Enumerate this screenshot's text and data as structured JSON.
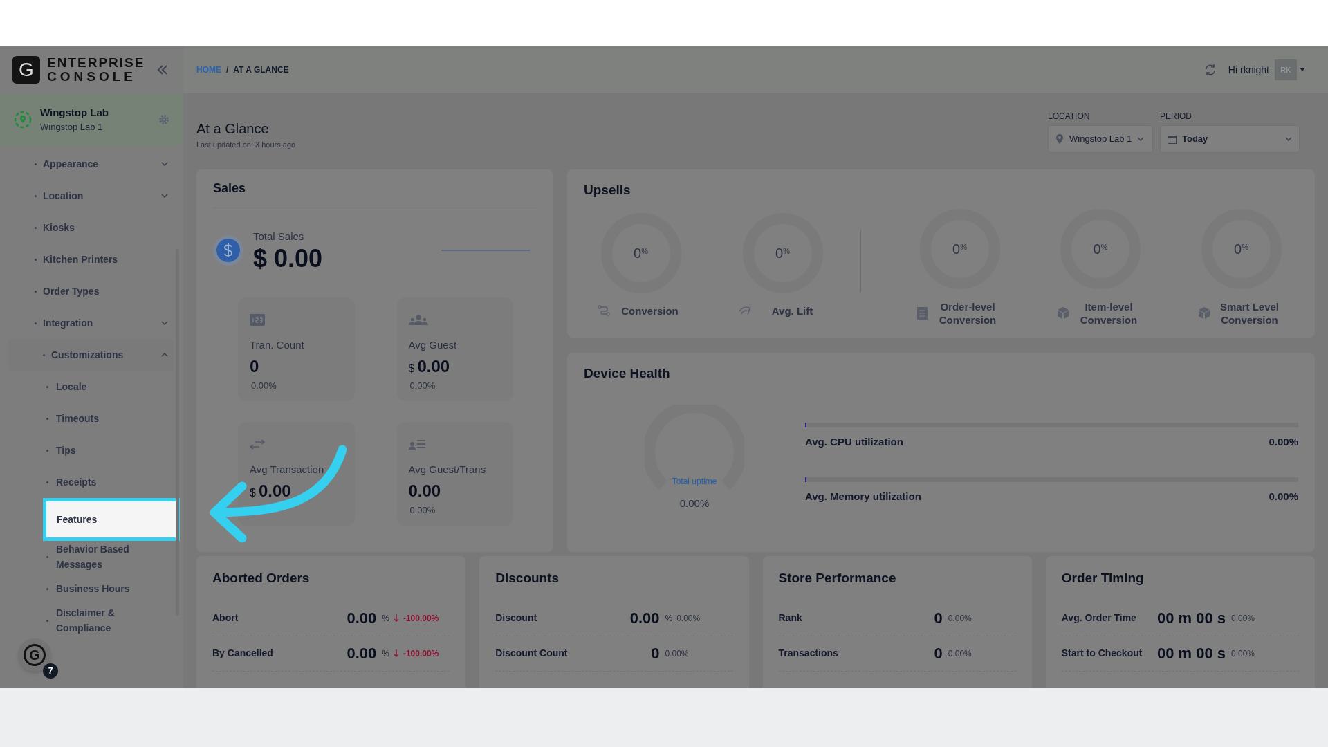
{
  "brand": {
    "logo_letter": "G",
    "line_1": "ENTERPRISE",
    "line_2": "CONSOLE"
  },
  "store": {
    "name": "Wingstop Lab",
    "subtitle": "Wingstop Lab 1"
  },
  "sidebar": {
    "items": [
      {
        "label": "Appearance",
        "expanded": false,
        "selected": false
      },
      {
        "label": "Location",
        "expanded": false,
        "selected": false
      },
      {
        "label": "Kiosks",
        "selected": false
      },
      {
        "label": "Kitchen Printers",
        "selected": false
      },
      {
        "label": "Order Types",
        "selected": false
      },
      {
        "label": "Integration",
        "expanded": false,
        "selected": false
      },
      {
        "label": "Customizations",
        "expanded": true,
        "selected": false,
        "children": [
          {
            "label": "Locale",
            "selected": false
          },
          {
            "label": "Timeouts",
            "selected": false
          },
          {
            "label": "Tips",
            "selected": false
          },
          {
            "label": "Receipts",
            "selected": false
          },
          {
            "label": "Features",
            "selected": true
          },
          {
            "label": "Behavior Based Messages",
            "selected": false
          },
          {
            "label": "Business Hours",
            "selected": false
          },
          {
            "label": "Disclaimer & Compliance",
            "selected": false
          }
        ]
      }
    ]
  },
  "breadcrumb": {
    "separator": "/",
    "items": [
      {
        "kind": "link",
        "label": "HOME"
      },
      {
        "kind": "current",
        "label": "AT A GLANCE"
      }
    ]
  },
  "user": {
    "greeting": "Hi rknight",
    "initials": "RK"
  },
  "page": {
    "title": "At a Glance",
    "subtitle": "Last updated on: 3 hours ago"
  },
  "filters": [
    {
      "kind": "location",
      "label": "LOCATION",
      "value": "Wingstop Lab 1"
    },
    {
      "kind": "period",
      "label": "PERIOD",
      "value": "Today"
    }
  ],
  "sales": {
    "title": "Sales",
    "total": {
      "label": "Total Sales",
      "currency": "$",
      "value": "0.00"
    },
    "metrics": [
      {
        "kind": "numbers",
        "label": "Tran. Count",
        "value": "0",
        "change": "0.00%"
      },
      {
        "kind": "group",
        "label": "Avg Guest",
        "currency": "$",
        "value": "0.00",
        "change": "0.00%"
      },
      {
        "kind": "swap",
        "label": "Avg Transaction",
        "currency": "$",
        "value": "0.00"
      },
      {
        "kind": "guest-list",
        "label": "Avg Guest/Trans",
        "value": "0.00",
        "change": "0.00%"
      }
    ]
  },
  "upsells": {
    "title": "Upsells",
    "groups": [
      [
        {
          "kind": "route",
          "label": "Conversion",
          "value": "0",
          "unit": "%"
        },
        {
          "kind": "signal",
          "label": "Avg. Lift",
          "value": "0",
          "unit": "%"
        }
      ],
      [
        {
          "kind": "list",
          "label": "Order-level Conversion",
          "value": "0",
          "unit": "%"
        },
        {
          "kind": "cube",
          "label": "Item-level Conversion",
          "value": "0",
          "unit": "%"
        },
        {
          "kind": "cube",
          "label": "Smart Level Conversion",
          "value": "0",
          "unit": "%"
        }
      ]
    ]
  },
  "device_health": {
    "title": "Device Health",
    "uptime": {
      "label": "Total uptime",
      "value": "0.00%"
    },
    "bars": [
      {
        "label": "Avg. CPU utilization",
        "value": "0.00%",
        "level": 0
      },
      {
        "label": "Avg. Memory utilization",
        "value": "0.00%",
        "level": 0
      }
    ]
  },
  "panels": [
    {
      "title": "Aborted Orders",
      "rows": [
        {
          "kind": "decrease",
          "label": "Abort",
          "value": "0.00",
          "unit": "%",
          "change": "-100.00%"
        },
        {
          "kind": "decrease",
          "label": "By Cancelled",
          "value": "0.00",
          "unit": "%",
          "change": "-100.00%"
        }
      ]
    },
    {
      "title": "Discounts",
      "rows": [
        {
          "kind": "neutral",
          "label": "Discount",
          "value": "0.00",
          "unit": "%",
          "change": "0.00%"
        },
        {
          "kind": "neutral",
          "label": "Discount Count",
          "value": "0",
          "change": "0.00%"
        }
      ]
    },
    {
      "title": "Store Performance",
      "rows": [
        {
          "kind": "neutral",
          "label": "Rank",
          "value": "0",
          "change": "0.00%"
        },
        {
          "kind": "neutral",
          "label": "Transactions",
          "value": "0",
          "change": "0.00%"
        }
      ]
    },
    {
      "title": "Order Timing",
      "rows": [
        {
          "kind": "neutral",
          "label": "Avg. Order Time",
          "value": "00 m 00 s",
          "change": "0.00%"
        },
        {
          "kind": "neutral",
          "label": "Start to Checkout",
          "value": "00 m 00 s",
          "change": "0.00%"
        }
      ]
    }
  ],
  "help_badge": {
    "letter": "G",
    "count": "7"
  }
}
